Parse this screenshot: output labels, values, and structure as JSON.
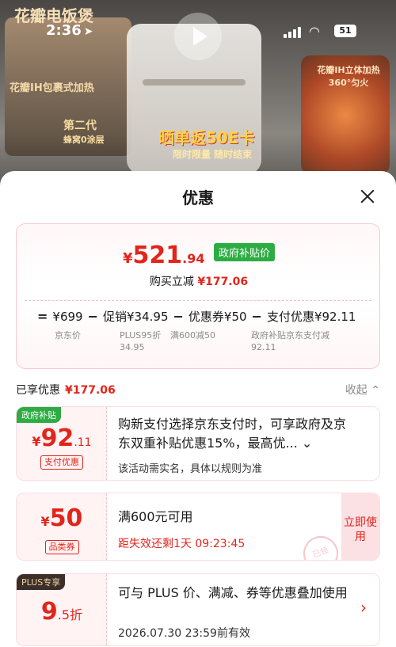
{
  "status_bar": {
    "time": "2:36",
    "battery": "51"
  },
  "banner": {
    "left_top": "花瓣电饭煲",
    "left_mid": "花瓣IH包裹式加热",
    "left_bottom_1": "第二代",
    "left_bottom_2": "蜂窝0涂层",
    "promo": "晒单返50E卡",
    "promo_sub": "限时限量 随时结束",
    "right_text": "花瓣IH立体加热 360°匀火"
  },
  "sheet": {
    "title": "优惠",
    "price": {
      "yen": "¥",
      "int": "521",
      "dec": ".94",
      "tag": "政府补贴价"
    },
    "buy_label": "购买立减",
    "buy_amount": "¥177.06",
    "formula": {
      "eq": "=",
      "base": "¥699",
      "minus": "−",
      "promo": "促销¥34.95",
      "coupon": "优惠券¥50",
      "pay": "支付优惠¥92.11",
      "base_sub": "京东价",
      "promo_sub": "PLUS95折 34.95",
      "coupon_sub": "满600减50",
      "pay_sub": "政府补贴京东支付减92.11"
    },
    "enjoyed_label": "已享优惠",
    "enjoyed_amount": "¥177.06",
    "collapse_label": "收起 ⌃"
  },
  "coupons": [
    {
      "tag": "政府补贴",
      "tag_color": "#2dac44",
      "yen": "¥",
      "num": "92",
      "dec": ".11",
      "label": "支付优惠",
      "text": "购新支付选择京东支付时，可享政府及京东双重补贴优惠15%，最高优... ⌄",
      "small": "该活动需实名，具体以规则为准"
    },
    {
      "yen": "¥",
      "num": "50",
      "label": "品类券",
      "text": "满600元可用",
      "small": "距失效还剩1天 09:23:45",
      "use_label": "立即使用",
      "stamp": "已领"
    },
    {
      "tag": "PLUS专享",
      "tag_color": "#3a2f2a",
      "num": "9",
      "dec": ".5折",
      "text": "可与 PLUS 价、满减、券等优惠叠加使用",
      "small": "2026.07.30 23:59前有效",
      "chevron": "›"
    }
  ]
}
